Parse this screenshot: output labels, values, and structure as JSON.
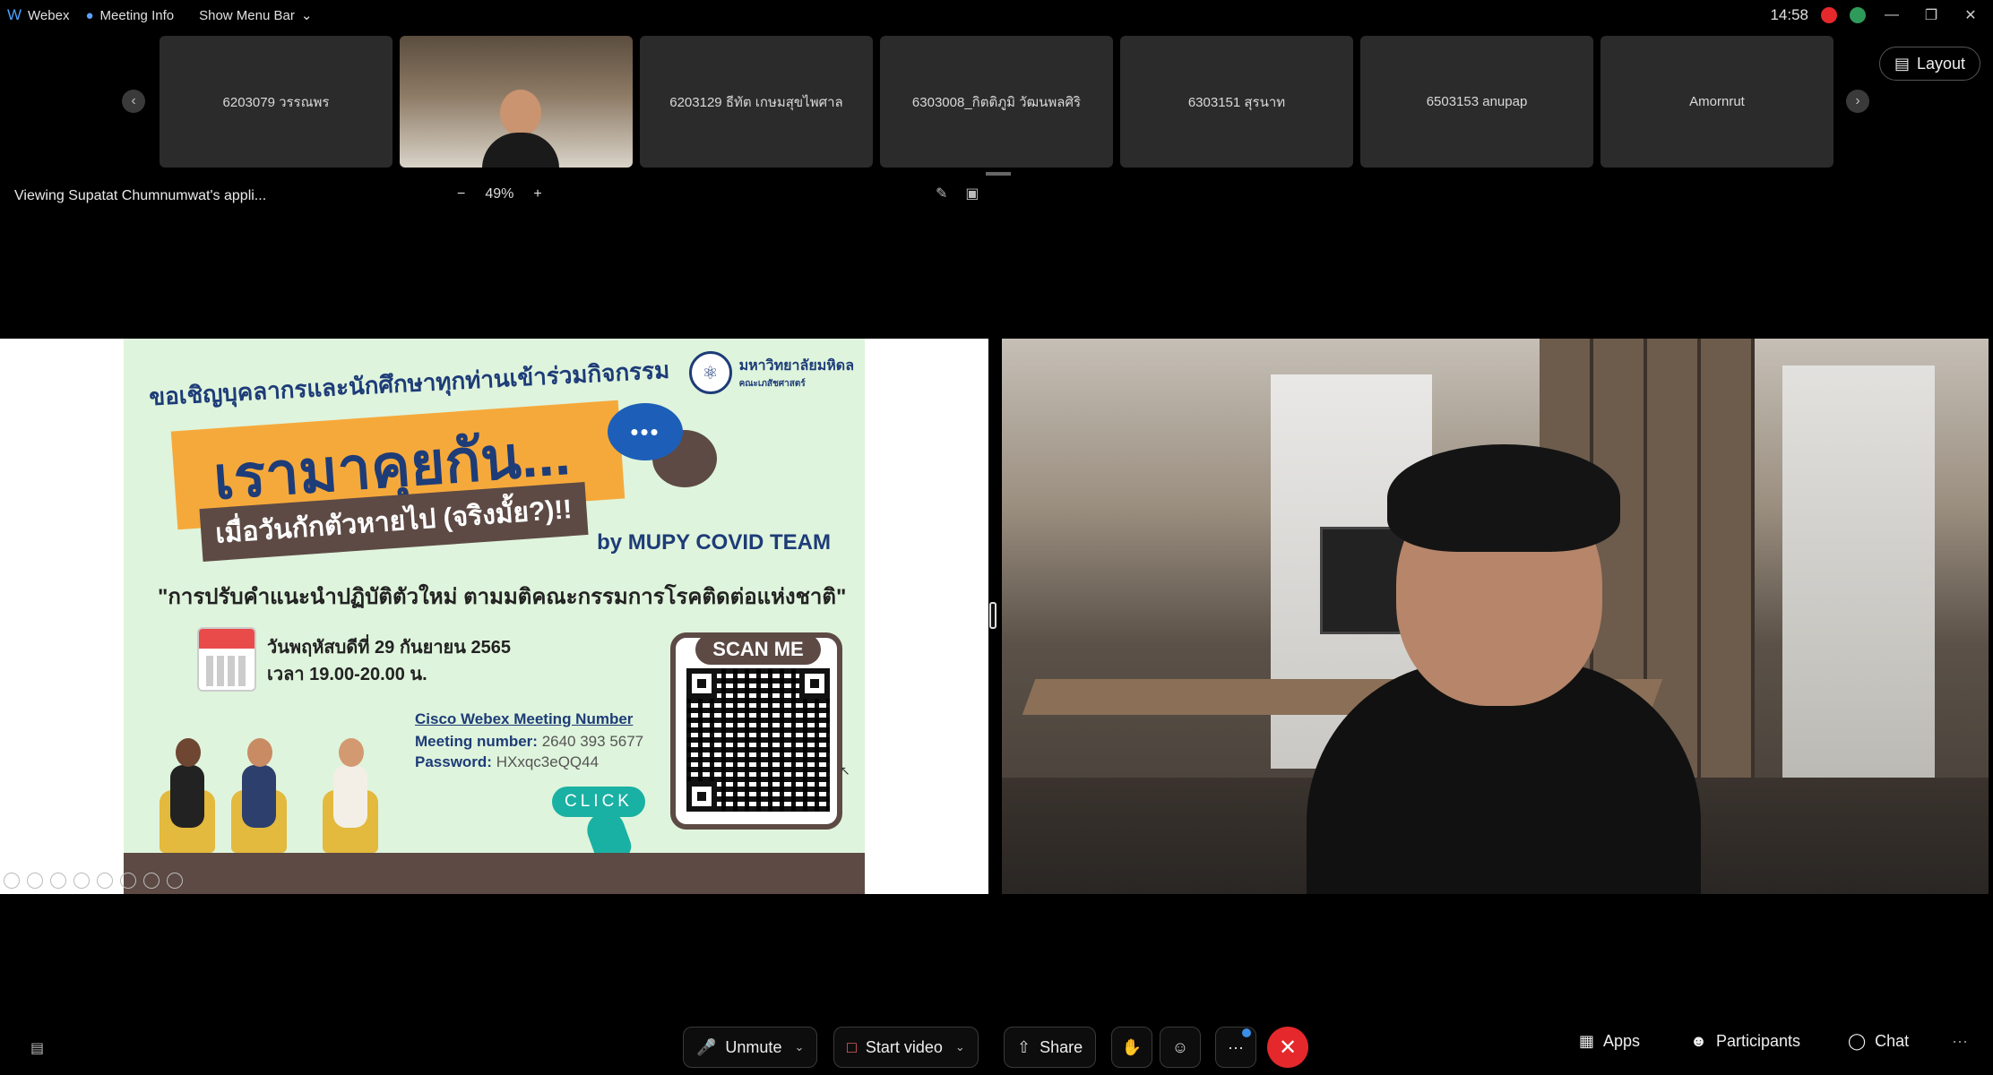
{
  "topbar": {
    "app_name": "Webex",
    "meeting_info": "Meeting Info",
    "show_menu_bar": "Show Menu Bar",
    "time": "14:58",
    "icons": [
      "webex-logo-icon",
      "shield-icon",
      "chevron-down-icon",
      "record-icon",
      "avatar-icon",
      "minimize-icon",
      "restore-icon",
      "close-icon"
    ]
  },
  "filmstrip": {
    "tiles": [
      {
        "label": "6203079 วรรณพร"
      },
      {
        "label": ""
      },
      {
        "label": "6203129 ธีทัต เกษมสุขไพศาล"
      },
      {
        "label": "6303008_กิตติภูมิ วัฒนพลศิริ"
      },
      {
        "label": "6303151 สุรนาท"
      },
      {
        "label": "6503153 anupap"
      },
      {
        "label": "Amornrut"
      }
    ],
    "layout_label": "Layout"
  },
  "status": {
    "viewing_text": "Viewing Supatat Chumnumwat's appli...",
    "zoom": "49%",
    "zoom_minus": "−",
    "zoom_plus": "+"
  },
  "poster": {
    "university_name": "มหาวิทยาลัยมหิดล",
    "faculty": "คณะเภสัชศาสตร์",
    "invite": "ขอเชิญบุคลากรและนักศึกษาทุกท่านเข้าร่วมกิจกรรม",
    "headline": "เรามาคุยกัน...",
    "subheadline": "เมื่อวันกักตัวหายไป (จริงมั้ย?)!!",
    "team": "by MUPY COVID TEAM",
    "quote": "\"การปรับคำแนะนำปฏิบัติตัวใหม่ ตามมติคณะกรรมการโรคติดต่อแห่งชาติ\"",
    "date_line": "วันพฤหัสบดีที่ 29 กันยายน 2565",
    "time_line": "เวลา 19.00-20.00 น.",
    "webex_title": "Cisco Webex Meeting Number",
    "meeting_number_label": "Meeting number:",
    "meeting_number": "2640 393 5677",
    "password_label": "Password:",
    "password": "HXxqc3eQQ44",
    "click_label": "CLICK",
    "scan_label": "SCAN ME"
  },
  "controls": {
    "unmute": "Unmute",
    "start_video": "Start video",
    "share": "Share",
    "more": "···",
    "apps": "Apps",
    "participants": "Participants",
    "chat": "Chat",
    "overflow": "···"
  }
}
